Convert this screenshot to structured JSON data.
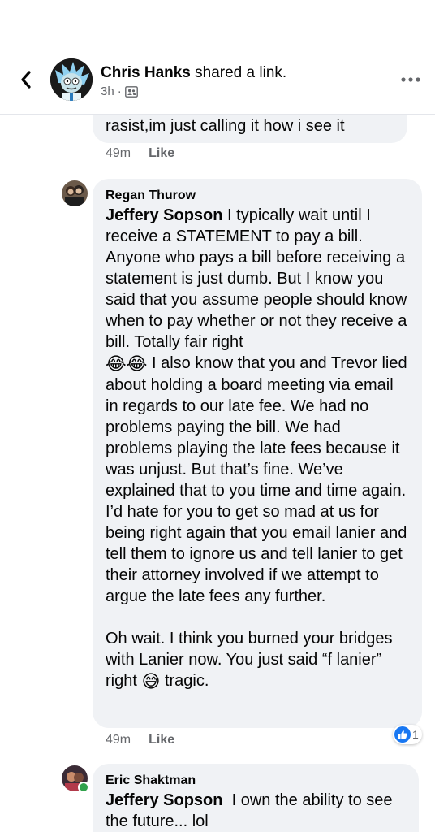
{
  "header": {
    "author": "Chris Hanks",
    "action": "shared a link.",
    "time": "3h",
    "separator": "·",
    "audience_icon": "friends-icon"
  },
  "comments": [
    {
      "text": "rasist,im just calling it how i see it",
      "time": "49m",
      "like_label": "Like"
    },
    {
      "author": "Regan Thurow",
      "mention": "Jeffery Sopson",
      "text_p1": " I typically wait until I receive a STATEMENT to pay a bill. Anyone who pays a bill before receiving a statement is just dumb. But I know you said that you assume people should know when to pay whether or not they receive a bill. Totally fair right",
      "text_p2": " I also know that you and Trevor lied about holding a board meeting via email in regards to our late fee. We had no problems paying the bill. We had problems playing the late fees because it was unjust. But that’s fine. We’ve explained that to you time and time again. I’d hate for you to get so mad at us for being right again that you email lanier and tell them to ignore us and tell lanier to get their attorney involved if we attempt to argue the late fees any further.",
      "text_p3": "Oh wait. I think you burned your bridges with Lanier now. You just said “f lanier”",
      "text_p4a": "right",
      "text_p4b": "tragic.",
      "emoji_laugh": "😂😂",
      "emoji_sweat": "😅",
      "time": "49m",
      "like_label": "Like",
      "reaction_count": "1"
    },
    {
      "author": "Eric Shaktman",
      "mention": "Jeffery Sopson",
      "text": "  I own the ability to see the future... lol"
    }
  ]
}
